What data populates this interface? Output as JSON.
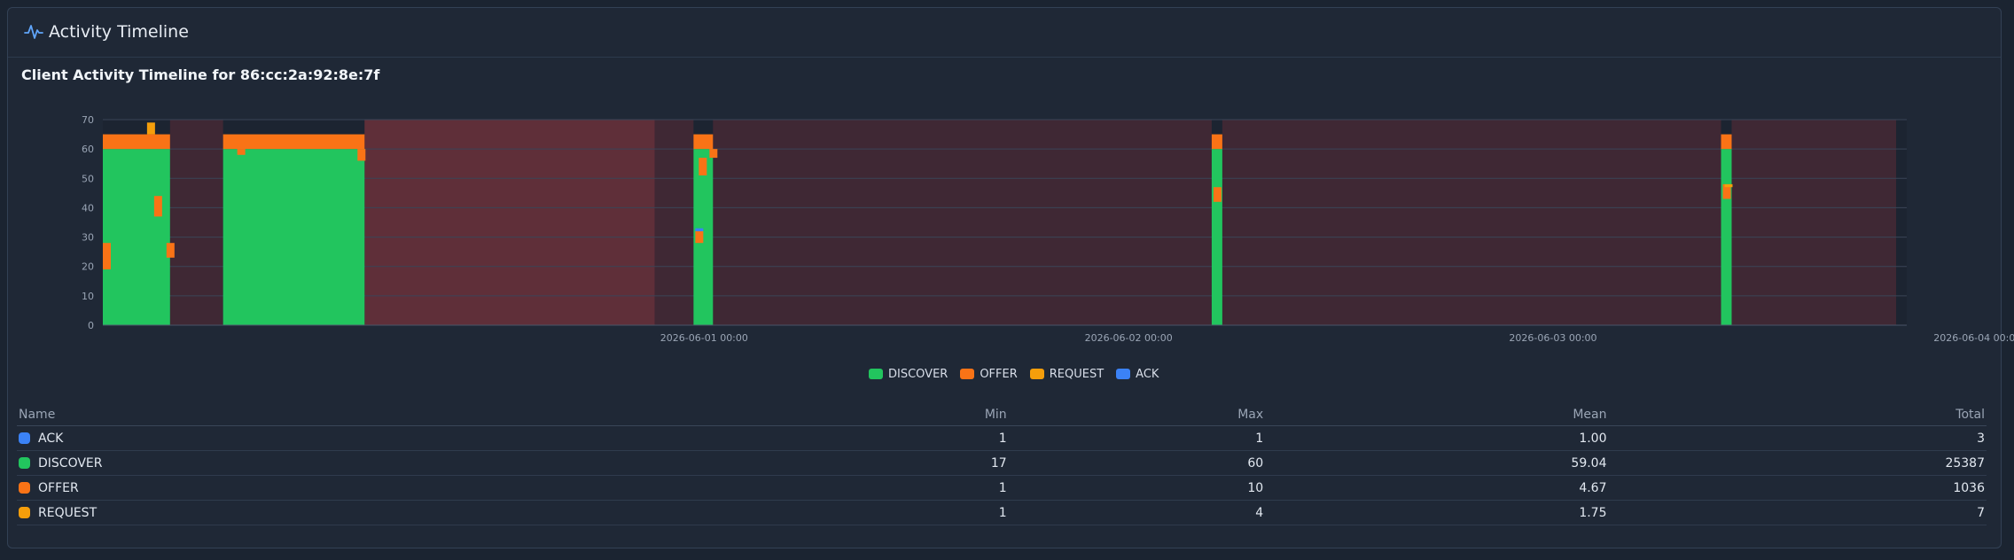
{
  "panel": {
    "title": "Activity Timeline",
    "icon": "activity-icon"
  },
  "chart_data": {
    "type": "bar",
    "title": "Client Activity Timeline for 86:cc:2a:92:8e:7f",
    "stacked": true,
    "ylim": [
      0,
      70
    ],
    "yticks": [
      0,
      10,
      20,
      30,
      40,
      50,
      60,
      70
    ],
    "x_tick_labels": [
      "2026-06-01 00:00",
      "2026-06-02 00:00",
      "2026-06-03 00:00",
      "2026-06-04 00:00"
    ],
    "grid": true,
    "legend_placement": "bottom-center",
    "series_colors": {
      "DISCOVER": "#22c55e",
      "OFFER": "#f97316",
      "REQUEST": "#f59e0b",
      "ACK": "#3b82f6"
    },
    "x_domain_hours": [
      -34,
      68
    ],
    "shaded_ranges": [
      {
        "kind": "gap",
        "from_hours": -30.2,
        "to_hours": -27.2
      },
      {
        "kind": "gap",
        "from_hours": -19.2,
        "to_hours": -0.6
      },
      {
        "kind": "gap",
        "from_hours": 0.5,
        "to_hours": 28.7
      },
      {
        "kind": "gap",
        "from_hours": 29.3,
        "to_hours": 57.5
      },
      {
        "kind": "gap",
        "from_hours": 58.1,
        "to_hours": 67.4
      }
    ],
    "highlight_range": {
      "from_hours": -19.2,
      "to_hours": -2.8
    },
    "activity_blocks": [
      {
        "from_hours": -34,
        "to_hours": -30.2,
        "DISCOVER": 60,
        "OFFER": 5,
        "REQUEST": 0,
        "ACK": 0
      },
      {
        "from_hours": -27.2,
        "to_hours": -19.2,
        "DISCOVER": 60,
        "OFFER": 5,
        "REQUEST": 0,
        "ACK": 0
      },
      {
        "from_hours": -0.6,
        "to_hours": 0.5,
        "DISCOVER": 60,
        "OFFER": 5,
        "REQUEST": 0,
        "ACK": 0
      },
      {
        "from_hours": 28.7,
        "to_hours": 29.3,
        "DISCOVER": 60,
        "OFFER": 5,
        "REQUEST": 0,
        "ACK": 0
      },
      {
        "from_hours": 57.5,
        "to_hours": 58.1,
        "DISCOVER": 60,
        "OFFER": 5,
        "REQUEST": 0,
        "ACK": 0
      }
    ],
    "markers": [
      {
        "hours": -34,
        "series": "OFFER",
        "y0": 19,
        "y1": 28
      },
      {
        "hours": -31.5,
        "series": "REQUEST",
        "y0": 65,
        "y1": 69
      },
      {
        "hours": -31.1,
        "series": "OFFER",
        "y0": 37,
        "y1": 44
      },
      {
        "hours": -30.4,
        "series": "OFFER",
        "y0": 23,
        "y1": 28
      },
      {
        "hours": -26.4,
        "series": "OFFER",
        "y0": 58,
        "y1": 60
      },
      {
        "hours": -19.6,
        "series": "OFFER",
        "y0": 56,
        "y1": 60
      },
      {
        "hours": -0.5,
        "series": "OFFER",
        "y0": 28,
        "y1": 32
      },
      {
        "hours": -0.5,
        "series": "ACK",
        "y0": 32,
        "y1": 33
      },
      {
        "hours": -0.3,
        "series": "OFFER",
        "y0": 51,
        "y1": 57
      },
      {
        "hours": 0.3,
        "series": "OFFER",
        "y0": 57,
        "y1": 60
      },
      {
        "hours": 28.8,
        "series": "OFFER",
        "y0": 42,
        "y1": 47
      },
      {
        "hours": 57.6,
        "series": "OFFER",
        "y0": 43,
        "y1": 48
      },
      {
        "hours": 57.7,
        "series": "REQUEST",
        "y0": 47,
        "y1": 48
      }
    ]
  },
  "legend": [
    {
      "label": "DISCOVER",
      "color": "#22c55e"
    },
    {
      "label": "OFFER",
      "color": "#f97316"
    },
    {
      "label": "REQUEST",
      "color": "#f59e0b"
    },
    {
      "label": "ACK",
      "color": "#3b82f6"
    }
  ],
  "stats_table": {
    "headers": [
      "Name",
      "Min",
      "Max",
      "Mean",
      "Total"
    ],
    "rows": [
      {
        "name": "ACK",
        "color": "#3b82f6",
        "min": "1",
        "max": "1",
        "mean": "1.00",
        "total": "3"
      },
      {
        "name": "DISCOVER",
        "color": "#22c55e",
        "min": "17",
        "max": "60",
        "mean": "59.04",
        "total": "25387"
      },
      {
        "name": "OFFER",
        "color": "#f97316",
        "min": "1",
        "max": "10",
        "mean": "4.67",
        "total": "1036"
      },
      {
        "name": "REQUEST",
        "color": "#f59e0b",
        "min": "1",
        "max": "4",
        "mean": "1.75",
        "total": "7"
      }
    ]
  }
}
